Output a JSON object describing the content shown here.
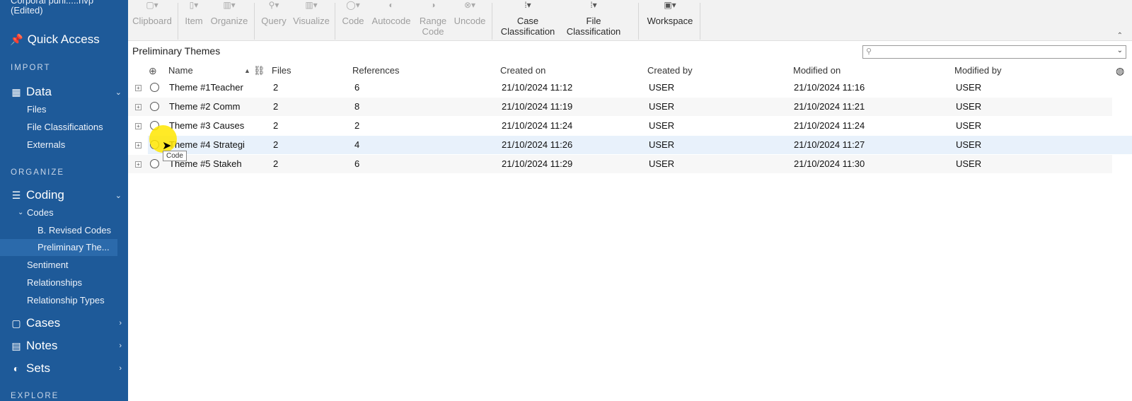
{
  "sidebar": {
    "project_title": "Corporal puni.....nvp (Edited)",
    "quick_access": "Quick Access",
    "import_head": "IMPORT",
    "data_group": "Data",
    "data_items": [
      "Files",
      "File Classifications",
      "Externals"
    ],
    "organize_head": "ORGANIZE",
    "coding_group": "Coding",
    "codes_label": "Codes",
    "codes_children": [
      "B. Revised Codes",
      "Preliminary The..."
    ],
    "coding_items": [
      "Sentiment",
      "Relationships",
      "Relationship Types"
    ],
    "cases_group": "Cases",
    "notes_group": "Notes",
    "sets_group": "Sets",
    "explore_head": "EXPLORE"
  },
  "ribbon": {
    "clipboard": "Clipboard",
    "item": "Item",
    "organize": "Organize",
    "query": "Query",
    "visualize": "Visualize",
    "code": "Code",
    "autocode": "Autocode",
    "range_code_1": "Range",
    "range_code_2": "Code",
    "uncode": "Uncode",
    "case_class_1": "Case",
    "case_class_2": "Classification",
    "file_class_1": "File",
    "file_class_2": "Classification",
    "workspace": "Workspace"
  },
  "content": {
    "title": "Preliminary Themes",
    "search_placeholder": ""
  },
  "table": {
    "columns": [
      "Name",
      "Files",
      "References",
      "Created on",
      "Created by",
      "Modified on",
      "Modified by"
    ],
    "rows": [
      {
        "name": "Theme #1Teacher",
        "files": "2",
        "references": "6",
        "created_on": "21/10/2024 11:12",
        "created_by": "USER",
        "modified_on": "21/10/2024 11:16",
        "modified_by": "USER"
      },
      {
        "name": "Theme #2  Comm",
        "files": "2",
        "references": "8",
        "created_on": "21/10/2024 11:19",
        "created_by": "USER",
        "modified_on": "21/10/2024 11:21",
        "modified_by": "USER"
      },
      {
        "name": "Theme #3 Causes",
        "files": "2",
        "references": "2",
        "created_on": "21/10/2024 11:24",
        "created_by": "USER",
        "modified_on": "21/10/2024 11:24",
        "modified_by": "USER"
      },
      {
        "name": "Theme #4 Strategi",
        "files": "2",
        "references": "4",
        "created_on": "21/10/2024 11:26",
        "created_by": "USER",
        "modified_on": "21/10/2024 11:27",
        "modified_by": "USER"
      },
      {
        "name": "Theme #5 Stakeh",
        "files": "2",
        "references": "6",
        "created_on": "21/10/2024 11:29",
        "created_by": "USER",
        "modified_on": "21/10/2024 11:30",
        "modified_by": "USER"
      }
    ]
  },
  "tooltip": "Code",
  "colors": {
    "sidebar_bg": "#1e5a99",
    "selected_row": "#e8f1fb",
    "cursor_highlight": "#ffe600"
  }
}
